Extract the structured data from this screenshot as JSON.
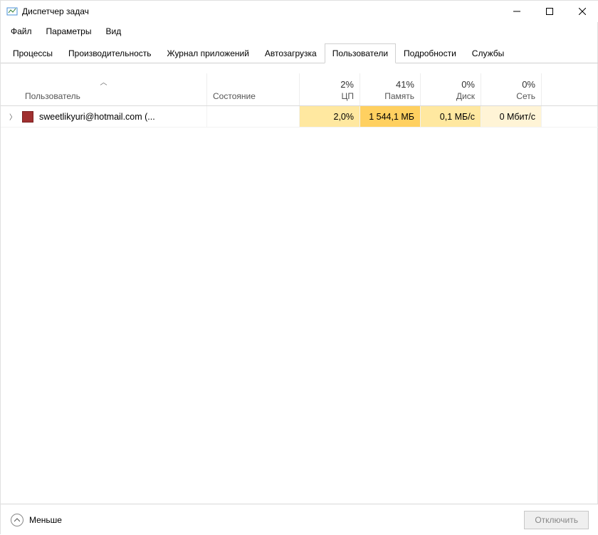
{
  "window": {
    "title": "Диспетчер задач"
  },
  "menubar": {
    "file": "Файл",
    "options": "Параметры",
    "view": "Вид"
  },
  "tabs": [
    {
      "label": "Процессы"
    },
    {
      "label": "Производительность"
    },
    {
      "label": "Журнал приложений"
    },
    {
      "label": "Автозагрузка"
    },
    {
      "label": "Пользователи",
      "active": true
    },
    {
      "label": "Подробности"
    },
    {
      "label": "Службы"
    }
  ],
  "columns": {
    "user": "Пользователь",
    "state": "Состояние",
    "cpu": {
      "pct": "2%",
      "label": "ЦП"
    },
    "memory": {
      "pct": "41%",
      "label": "Память"
    },
    "disk": {
      "pct": "0%",
      "label": "Диск"
    },
    "network": {
      "pct": "0%",
      "label": "Сеть"
    }
  },
  "rows": [
    {
      "user": "sweetlikyuri@hotmail.com (...",
      "state": "",
      "cpu": "2,0%",
      "memory": "1 544,1 МБ",
      "disk": "0,1 МБ/с",
      "network": "0 Мбит/с"
    }
  ],
  "footer": {
    "less": "Меньше",
    "disconnect": "Отключить"
  }
}
